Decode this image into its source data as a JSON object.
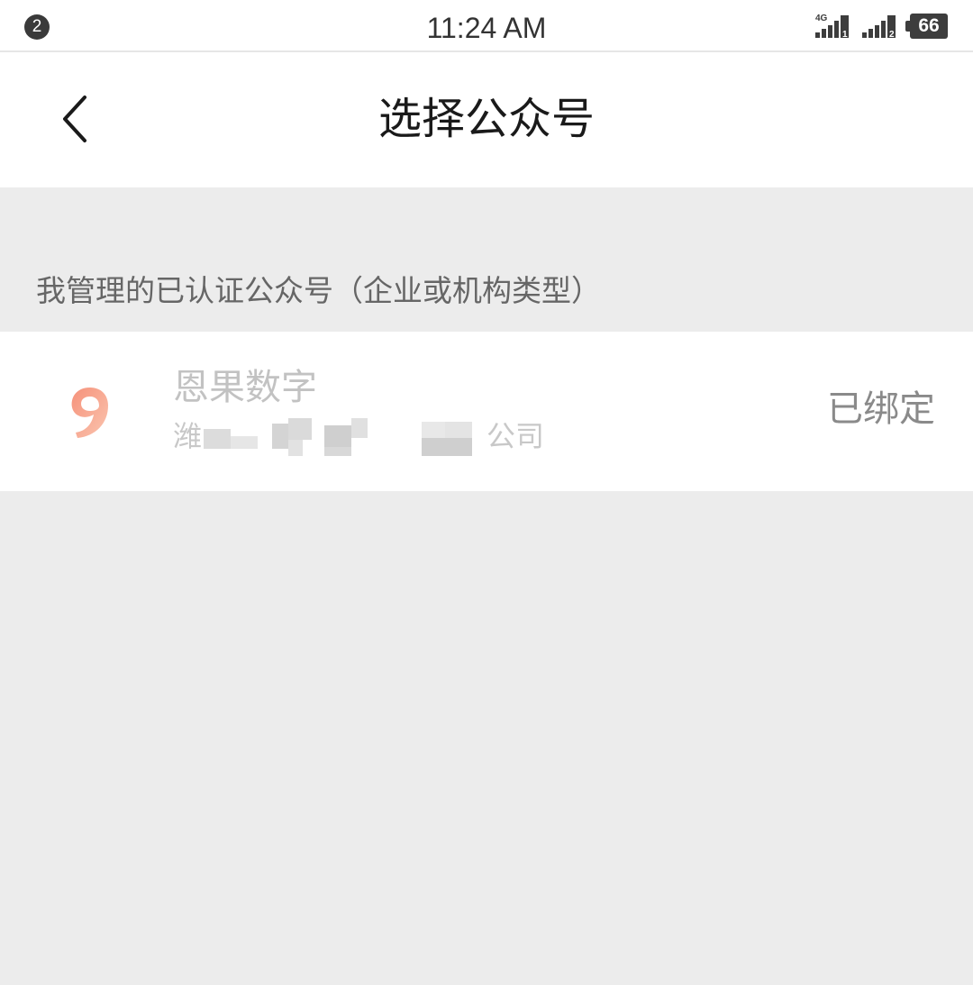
{
  "status_bar": {
    "notification_count": "2",
    "time": "11:24 AM",
    "sim1_network": "4G",
    "sim1_label": "1",
    "sim2_label": "2",
    "battery_level": "66"
  },
  "nav": {
    "back_icon": "chevron-left-icon",
    "title": "选择公众号"
  },
  "section": {
    "title": "我管理的已认证公众号（企业或机构类型）"
  },
  "accounts": [
    {
      "avatar_icon": "account-logo-icon",
      "name": "恩果数字",
      "company_prefix": "潍",
      "company_suffix": "公司",
      "status": "已绑定"
    }
  ],
  "colors": {
    "background": "#ececec",
    "surface": "#ffffff",
    "title_text": "#1a1a1a",
    "section_text": "#666666",
    "disabled_text": "#c2c2c2",
    "status_text": "#8a8a8a",
    "avatar_accent": "#f47e63"
  }
}
